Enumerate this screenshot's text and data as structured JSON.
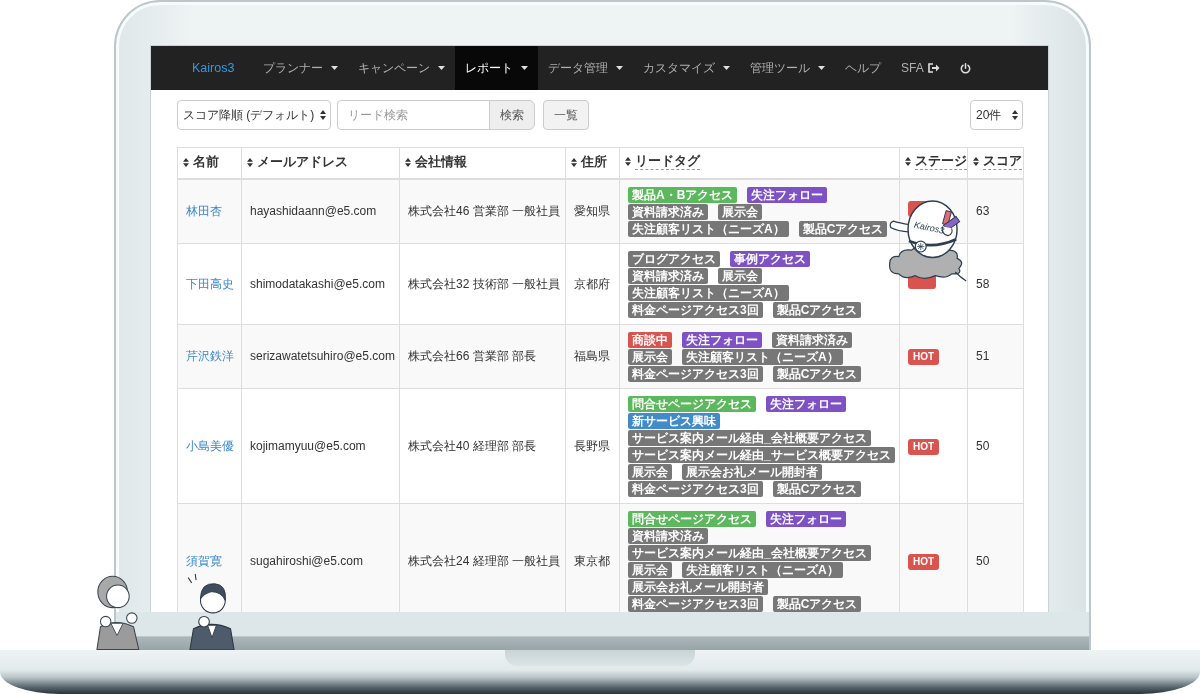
{
  "navbar": {
    "brand": "Kairos3",
    "items": [
      {
        "kind": "dropdown",
        "label": "プランナー",
        "selected": false
      },
      {
        "kind": "dropdown",
        "label": "キャンペーン",
        "selected": false
      },
      {
        "kind": "dropdown",
        "label": "レポート",
        "selected": true
      },
      {
        "kind": "dropdown",
        "label": "データ管理",
        "selected": false
      },
      {
        "kind": "dropdown",
        "label": "カスタマイズ",
        "selected": false
      },
      {
        "kind": "dropdown",
        "label": "管理ツール",
        "selected": false
      },
      {
        "kind": "link",
        "label": "ヘルプ",
        "selected": false
      },
      {
        "kind": "external",
        "label": "SFA",
        "selected": false
      },
      {
        "kind": "power",
        "selected": false
      }
    ]
  },
  "toolbar": {
    "sort_select": {
      "value": "スコア降順 (デフォルト)"
    },
    "search": {
      "placeholder": "リード検索",
      "button": "検索"
    },
    "list_button": "一覧",
    "page_size_select": {
      "value": "20件"
    }
  },
  "table": {
    "columns": [
      {
        "label": "名前",
        "has_tooltip": false
      },
      {
        "label": "メールアドレス",
        "has_tooltip": false
      },
      {
        "label": "会社情報",
        "has_tooltip": false
      },
      {
        "label": "住所",
        "has_tooltip": false
      },
      {
        "label": "リードタグ",
        "has_tooltip": true
      },
      {
        "label": "ステージ",
        "has_tooltip": true
      },
      {
        "label": "スコア",
        "has_tooltip": true
      }
    ],
    "rows": [
      {
        "name": "林田杏",
        "email": "hayashidaann@e5.com",
        "company": "株式会社46 営業部 一般社員",
        "address": "愛知県",
        "tags": [
          {
            "label": "製品A・Bアクセス",
            "color": "#5cb85c"
          },
          {
            "label": "失注フォロー",
            "color": "#7e52c4"
          },
          {
            "label": "資料請求済み",
            "color": "#777777"
          },
          {
            "label": "展示会",
            "color": "#777777"
          },
          {
            "label": "失注顧客リスト（ニーズA）",
            "color": "#777777"
          },
          {
            "label": "製品Cアクセス",
            "color": "#777777"
          }
        ],
        "stage": {
          "kind": "hot"
        },
        "score": "63"
      },
      {
        "name": "下田高史",
        "email": "shimodatakashi@e5.com",
        "company": "株式会社32 技術部 一般社員",
        "address": "京都府",
        "tags": [
          {
            "label": "ブログアクセス",
            "color": "#777777"
          },
          {
            "label": "事例アクセス",
            "color": "#7e52c4"
          },
          {
            "label": "資料請求済み",
            "color": "#777777"
          },
          {
            "label": "展示会",
            "color": "#777777"
          },
          {
            "label": "失注顧客リスト（ニーズA）",
            "color": "#777777"
          },
          {
            "label": "料金ページアクセス3回",
            "color": "#777777"
          },
          {
            "label": "製品Cアクセス",
            "color": "#777777"
          }
        ],
        "stage": {
          "kind": "hot"
        },
        "score": "58"
      },
      {
        "name": "芹沢鉄洋",
        "email": "serizawatetsuhiro@e5.com",
        "company": "株式会社66 営業部 部長",
        "address": "福島県",
        "tags": [
          {
            "label": "商談中",
            "color": "#d9534f"
          },
          {
            "label": "失注フォロー",
            "color": "#7e52c4"
          },
          {
            "label": "資料請求済み",
            "color": "#777777"
          },
          {
            "label": "展示会",
            "color": "#777777"
          },
          {
            "label": "失注顧客リスト（ニーズA）",
            "color": "#777777"
          },
          {
            "label": "料金ページアクセス3回",
            "color": "#777777"
          },
          {
            "label": "製品Cアクセス",
            "color": "#777777"
          }
        ],
        "stage": {
          "kind": "hot",
          "label": "HOT"
        },
        "score": "51"
      },
      {
        "name": "小島美優",
        "email": "kojimamyuu@e5.com",
        "company": "株式会社40 経理部 部長",
        "address": "長野県",
        "tags": [
          {
            "label": "問合せページアクセス",
            "color": "#5cb85c"
          },
          {
            "label": "失注フォロー",
            "color": "#7e52c4"
          },
          {
            "label": "新サービス興味",
            "color": "#428bca"
          },
          {
            "label": "サービス案内メール経由_会社概要アクセス",
            "color": "#777777"
          },
          {
            "label": "サービス案内メール経由_サービス概要アクセス",
            "color": "#777777"
          },
          {
            "label": "展示会",
            "color": "#777777"
          },
          {
            "label": "展示会お礼メール開封者",
            "color": "#777777"
          },
          {
            "label": "料金ページアクセス3回",
            "color": "#777777"
          },
          {
            "label": "製品Cアクセス",
            "color": "#777777"
          }
        ],
        "stage": {
          "kind": "hot",
          "label": "HOT"
        },
        "score": "50"
      },
      {
        "name": "須賀寛",
        "email": "sugahiroshi@e5.com",
        "company": "株式会社24 経理部 一般社員",
        "address": "東京都",
        "tags": [
          {
            "label": "問合せページアクセス",
            "color": "#5cb85c"
          },
          {
            "label": "失注フォロー",
            "color": "#7e52c4"
          },
          {
            "label": "資料請求済み",
            "color": "#777777"
          },
          {
            "label": "サービス案内メール経由_会社概要アクセス",
            "color": "#777777"
          },
          {
            "label": "展示会",
            "color": "#777777"
          },
          {
            "label": "失注顧客リスト（ニーズA）",
            "color": "#777777"
          },
          {
            "label": "展示会お礼メール開封者",
            "color": "#777777"
          },
          {
            "label": "料金ページアクセス3回",
            "color": "#777777"
          },
          {
            "label": "製品Cアクセス",
            "color": "#777777"
          }
        ],
        "stage": {
          "kind": "hot",
          "label": "HOT"
        },
        "score": "50"
      }
    ]
  },
  "mascot": {
    "label": "Kairos3"
  }
}
